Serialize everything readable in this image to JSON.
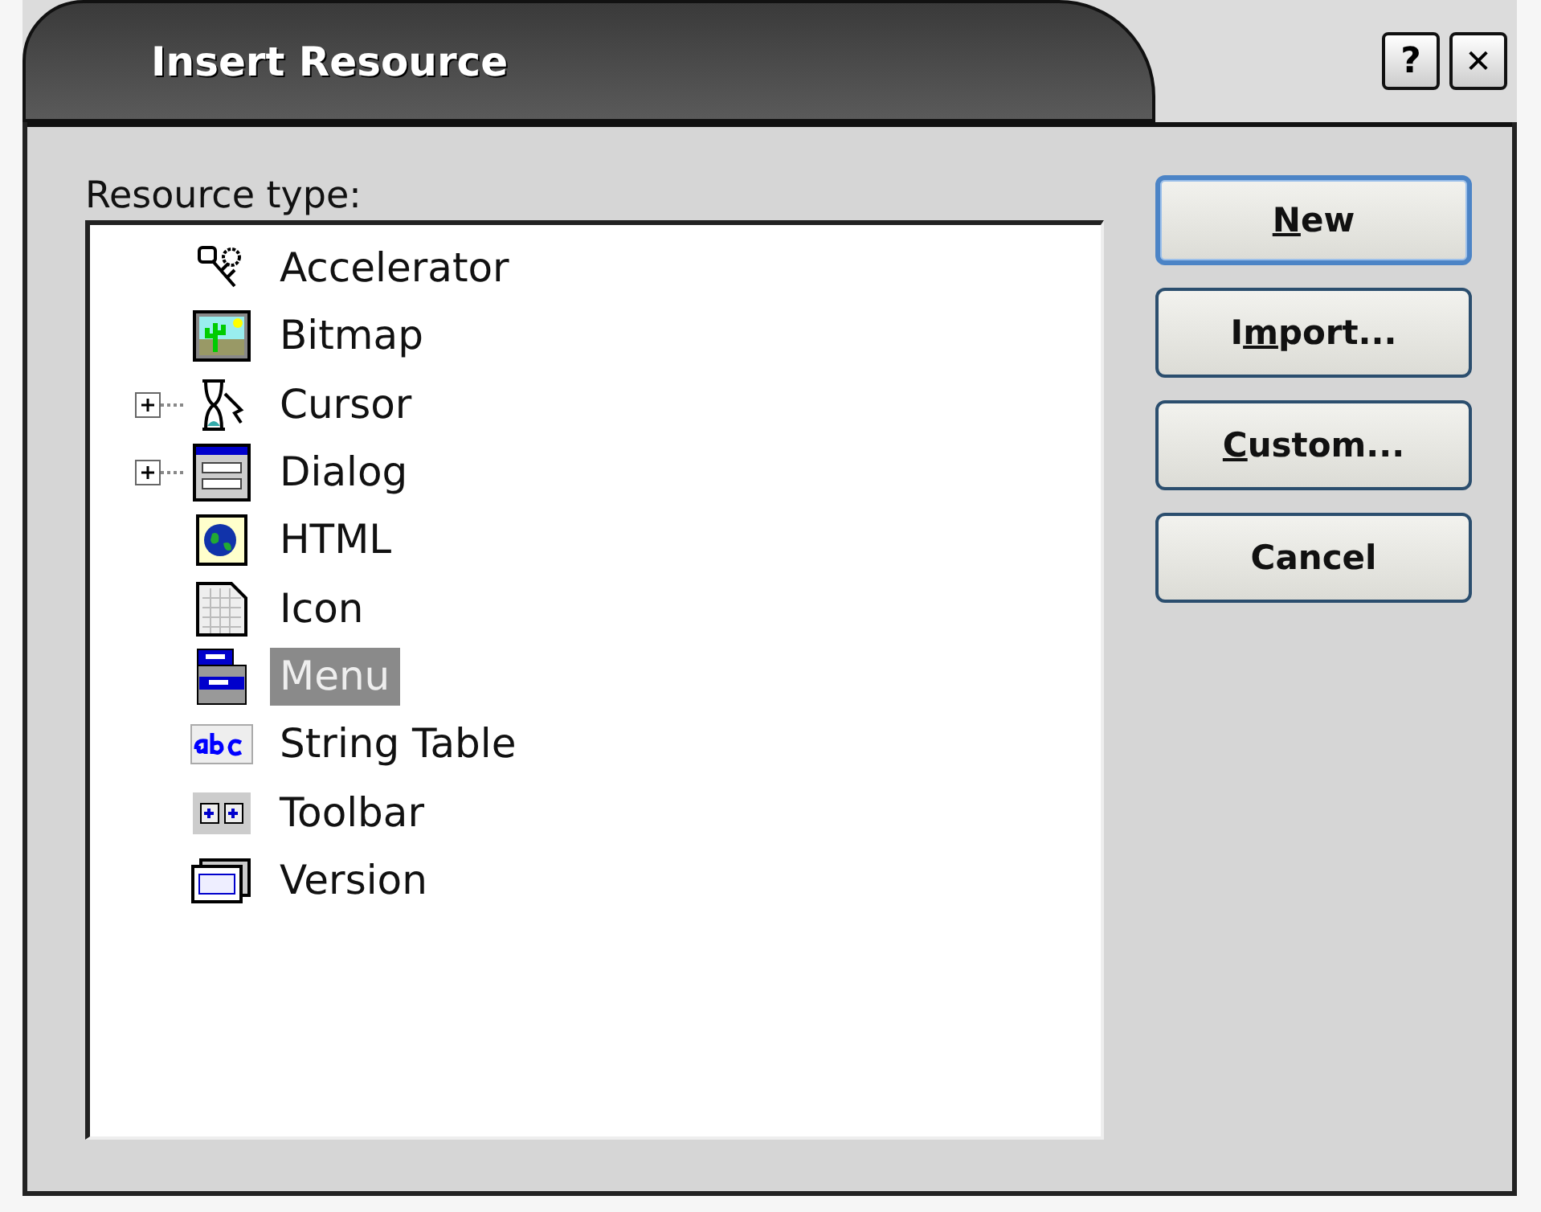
{
  "window": {
    "title": "Insert Resource",
    "controls": [
      {
        "kind": "help",
        "label": "?"
      },
      {
        "kind": "close",
        "label": "✕"
      }
    ]
  },
  "tree": {
    "label": "Resource type:",
    "items": [
      {
        "kind": "accelerator",
        "label": "Accelerator",
        "selected": false
      },
      {
        "kind": "bitmap",
        "label": "Bitmap",
        "selected": false
      },
      {
        "kind": "cursor",
        "label": "Cursor",
        "selected": false,
        "expanded": false
      },
      {
        "kind": "dialog",
        "label": "Dialog",
        "selected": false,
        "expanded": false
      },
      {
        "kind": "html",
        "label": "HTML",
        "selected": false
      },
      {
        "kind": "icon",
        "label": "Icon",
        "selected": false
      },
      {
        "kind": "menu",
        "label": "Menu",
        "selected": true
      },
      {
        "kind": "string",
        "label": "String Table",
        "selected": false
      },
      {
        "kind": "toolbar",
        "label": "Toolbar",
        "selected": false
      },
      {
        "kind": "version",
        "label": "Version",
        "selected": false
      }
    ]
  },
  "buttons": [
    {
      "access_key": "N",
      "after": "ew",
      "default": true
    },
    {
      "before": "I",
      "access_key": "m",
      "after": "port...",
      "default": false
    },
    {
      "access_key": "C",
      "after": "ustom...",
      "default": false
    },
    {
      "before": "Cancel",
      "default": false
    }
  ]
}
